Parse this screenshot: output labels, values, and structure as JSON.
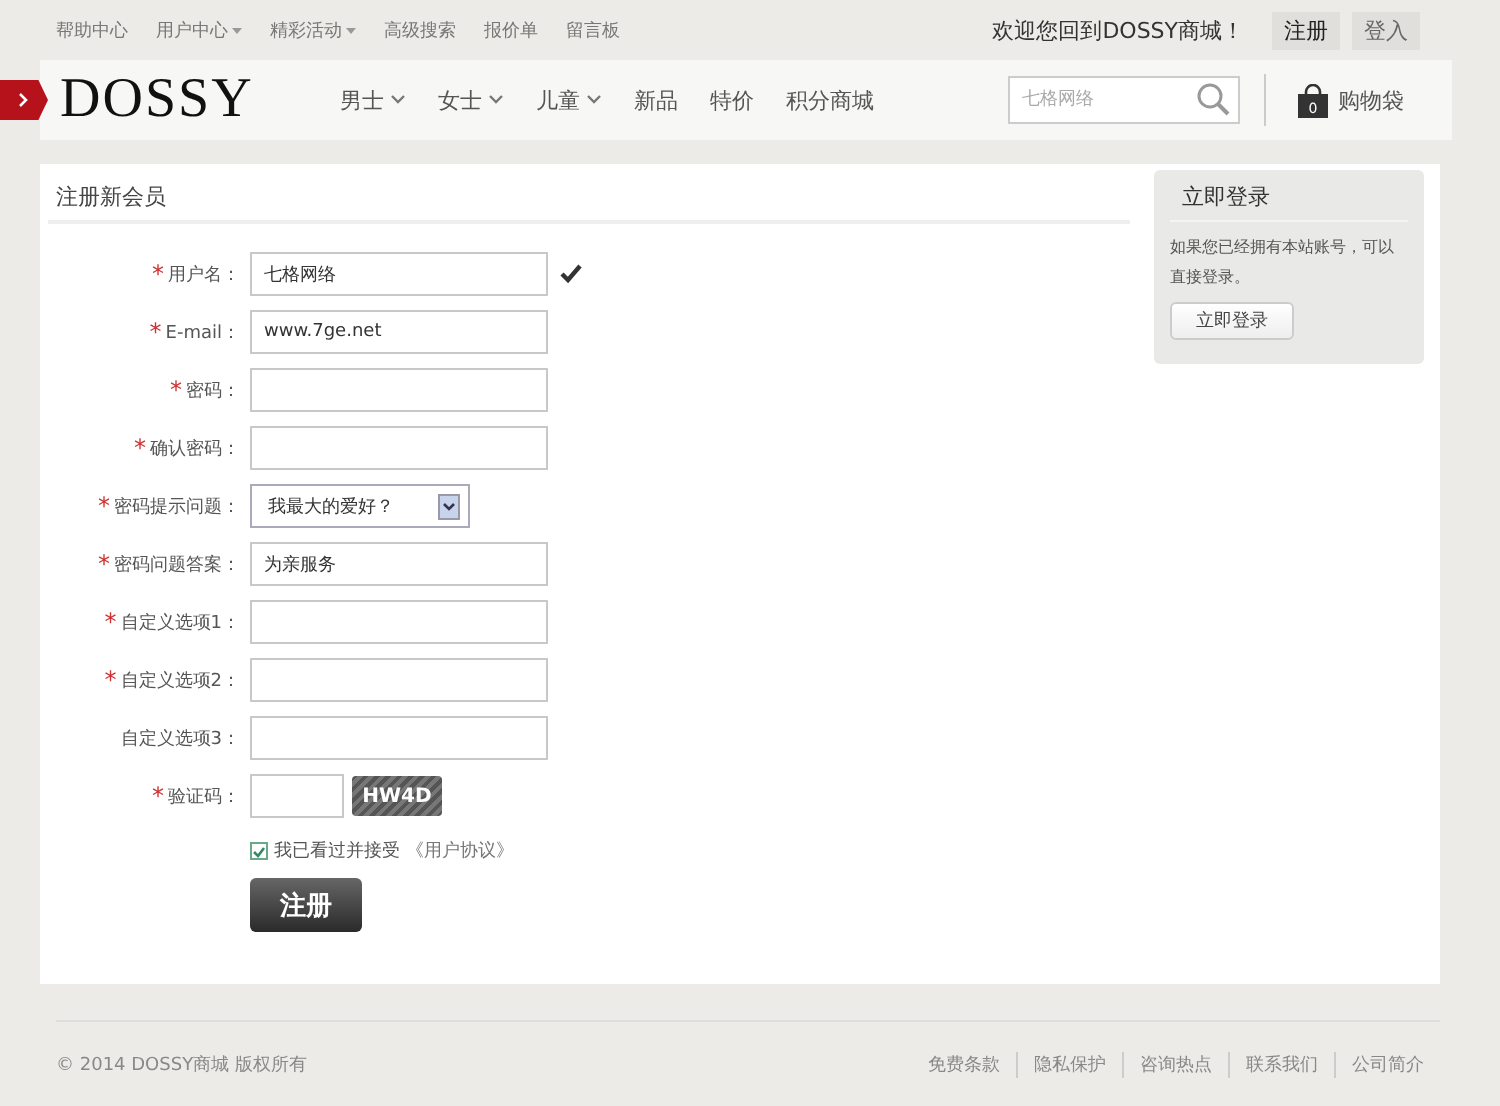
{
  "top_links": [
    {
      "label": "帮助中心",
      "dropdown": false
    },
    {
      "label": "用户中心",
      "dropdown": true
    },
    {
      "label": "精彩活动",
      "dropdown": true
    },
    {
      "label": "高级搜索",
      "dropdown": false
    },
    {
      "label": "报价单",
      "dropdown": false
    },
    {
      "label": "留言板",
      "dropdown": false
    }
  ],
  "welcome": "欢迎您回到DOSSY商城！",
  "account_buttons": [
    "注册",
    "登入"
  ],
  "logo": "DOSSY",
  "nav": [
    {
      "label": "男士",
      "dropdown": true
    },
    {
      "label": "女士",
      "dropdown": true
    },
    {
      "label": "儿童",
      "dropdown": true
    },
    {
      "label": "新品",
      "dropdown": false
    },
    {
      "label": "特价",
      "dropdown": false
    },
    {
      "label": "积分商城",
      "dropdown": false
    }
  ],
  "search": {
    "placeholder": "七格网络"
  },
  "cart": {
    "count": "0",
    "label": "购物袋"
  },
  "form": {
    "title": "注册新会员",
    "fields": [
      {
        "kind": "text",
        "mark": "*",
        "label": "用户名：",
        "value": "七格网络",
        "valid": true
      },
      {
        "kind": "text",
        "mark": "*",
        "label": "E-mail：",
        "value": "www.7ge.net",
        "valid": false
      },
      {
        "kind": "text",
        "mark": "*",
        "label": "密码：",
        "valid": false
      },
      {
        "kind": "text",
        "mark": "*",
        "label": "确认密码：",
        "valid": false
      },
      {
        "kind": "select",
        "mark": "*",
        "label": "密码提示问题：",
        "value": "我最大的爱好？",
        "valid": false
      },
      {
        "kind": "text",
        "mark": "*",
        "label": "密码问题答案：",
        "value": "为亲服务",
        "valid": false
      },
      {
        "kind": "text",
        "mark": "*",
        "label": "自定义选项1：",
        "valid": false
      },
      {
        "kind": "text",
        "mark": "*",
        "label": "自定义选项2：",
        "valid": false
      },
      {
        "kind": "text",
        "label": "自定义选项3：",
        "valid": false
      },
      {
        "kind": "captcha",
        "mark": "*",
        "label": "验证码：",
        "valid": false,
        "code": "HW4D"
      }
    ],
    "agreement": {
      "checked": true,
      "text": "我已看过并接受",
      "link": "《用户协议》"
    },
    "submit": "注册"
  },
  "login_box": {
    "title": "立即登录",
    "text": "如果您已经拥有本站账号，可以直接登录。",
    "button": "立即登录"
  },
  "footer": {
    "copyright": "© 2014 DOSSY商城 版权所有",
    "links": [
      "免费条款",
      "隐私保护",
      "咨询热点",
      "联系我们",
      "公司简介"
    ]
  }
}
